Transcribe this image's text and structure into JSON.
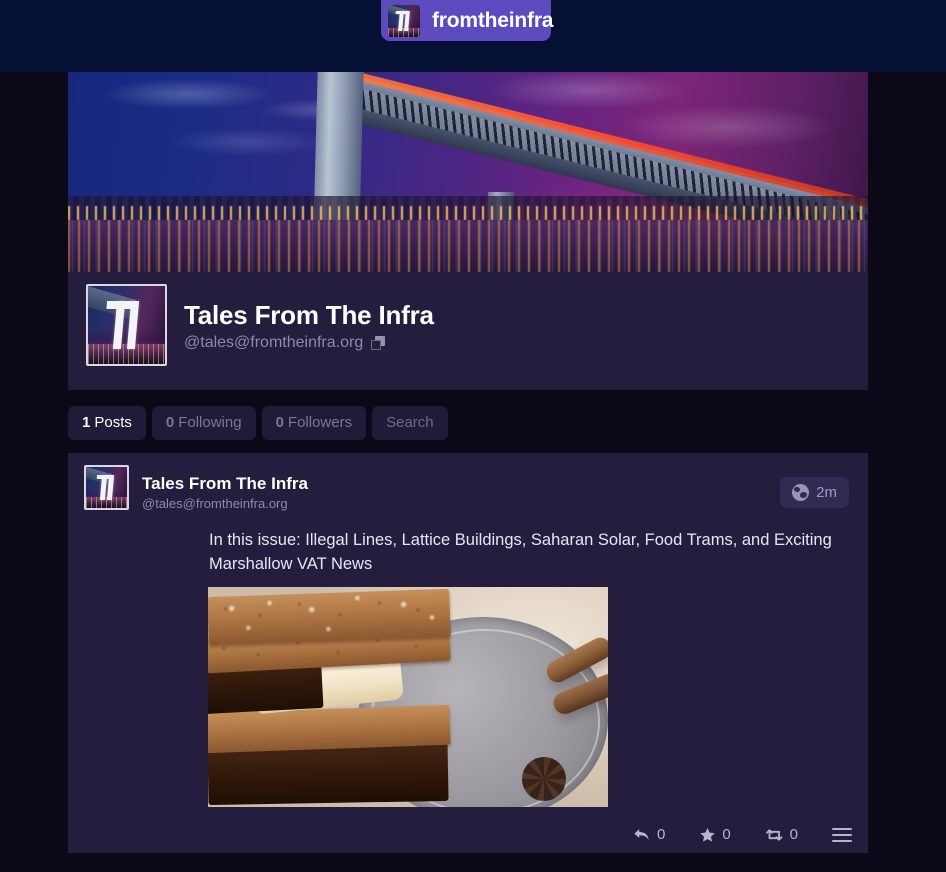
{
  "header": {
    "site_name": "fromtheinfra",
    "logo_icon": "ti-monogram-logo",
    "accent_color": "#5b4bbf"
  },
  "profile": {
    "banner_image": "night-bridge-city-photo",
    "avatar_icon": "ti-monogram-avatar",
    "display_name": "Tales From The Infra",
    "handle": "@tales@fromtheinfra.org",
    "copy_icon": "copy-icon"
  },
  "tabs": [
    {
      "count": "1",
      "label": "Posts",
      "active": true
    },
    {
      "count": "0",
      "label": "Following",
      "active": false
    },
    {
      "count": "0",
      "label": "Followers",
      "active": false
    },
    {
      "count": "",
      "label": "Search",
      "active": false
    }
  ],
  "post": {
    "author": "Tales From The Infra",
    "handle": "@tales@fromtheinfra.org",
    "visibility_icon": "globe-icon",
    "timestamp": "2m",
    "text": "In this issue: Illegal Lines, Lattice Buildings, Saharan Solar, Food Trams, and Exciting Marshallow VAT News",
    "attachment_image": "smores-graham-cracker-photo",
    "actions": {
      "reply_icon": "reply-arrow-icon",
      "reply_count": "0",
      "favourite_icon": "star-icon",
      "favourite_count": "0",
      "boost_icon": "boost-repeat-icon",
      "boost_count": "0",
      "menu_icon": "hamburger-menu-icon"
    }
  },
  "theme": {
    "page_background": "#0b0817",
    "card_background": "#241d3d",
    "top_background": "#060f34"
  }
}
